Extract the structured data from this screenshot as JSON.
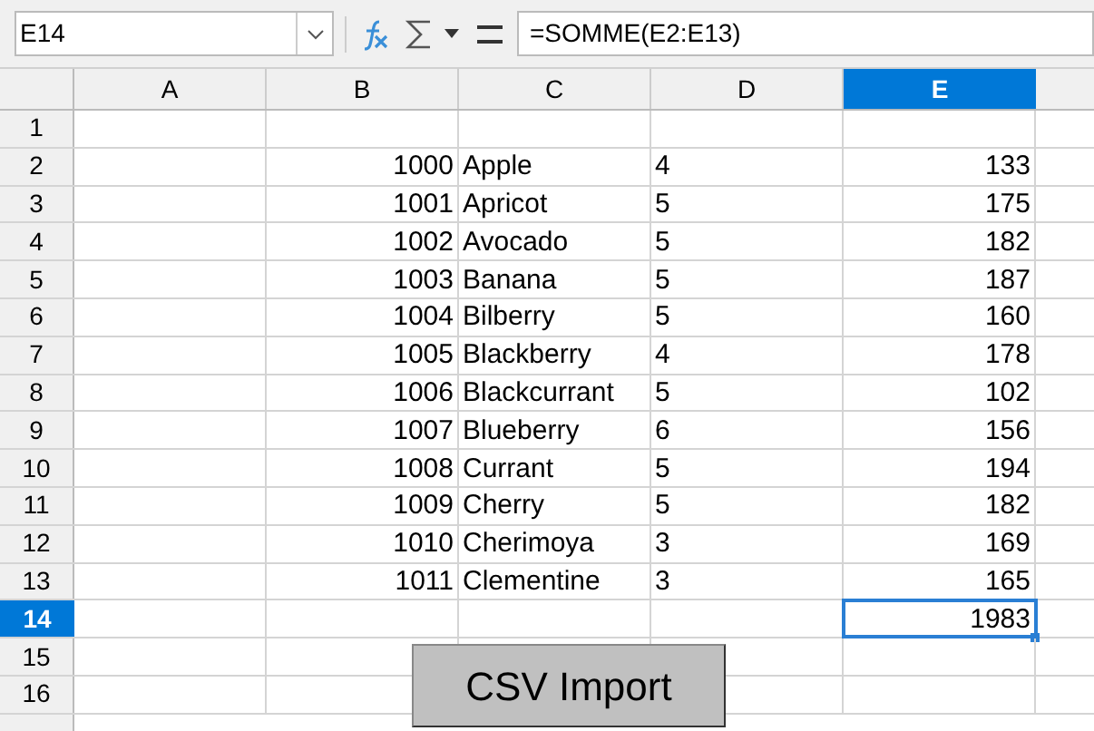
{
  "name_box": "E14",
  "formula": "=SOMME(E2:E13)",
  "columns": [
    {
      "label": "A",
      "selected": false,
      "kind": "text"
    },
    {
      "label": "B",
      "selected": false,
      "kind": "number"
    },
    {
      "label": "C",
      "selected": false,
      "kind": "text"
    },
    {
      "label": "D",
      "selected": false,
      "kind": "text"
    },
    {
      "label": "E",
      "selected": true,
      "kind": "number"
    }
  ],
  "rows": [
    {
      "label": "1",
      "selected": false,
      "cells": []
    },
    {
      "label": "2",
      "selected": false,
      "cells": [
        "",
        "1000",
        "Apple",
        "4",
        "133"
      ]
    },
    {
      "label": "3",
      "selected": false,
      "cells": [
        "",
        "1001",
        "Apricot",
        "5",
        "175"
      ]
    },
    {
      "label": "4",
      "selected": false,
      "cells": [
        "",
        "1002",
        "Avocado",
        "5",
        "182"
      ]
    },
    {
      "label": "5",
      "selected": false,
      "cells": [
        "",
        "1003",
        "Banana",
        "5",
        "187"
      ]
    },
    {
      "label": "6",
      "selected": false,
      "cells": [
        "",
        "1004",
        "Bilberry",
        "5",
        "160"
      ]
    },
    {
      "label": "7",
      "selected": false,
      "cells": [
        "",
        "1005",
        "Blackberry",
        "4",
        "178"
      ]
    },
    {
      "label": "8",
      "selected": false,
      "cells": [
        "",
        "1006",
        "Blackcurrant",
        "5",
        "102"
      ]
    },
    {
      "label": "9",
      "selected": false,
      "cells": [
        "",
        "1007",
        "Blueberry",
        "6",
        "156"
      ]
    },
    {
      "label": "10",
      "selected": false,
      "cells": [
        "",
        "1008",
        "Currant",
        "5",
        "194"
      ]
    },
    {
      "label": "11",
      "selected": false,
      "cells": [
        "",
        "1009",
        "Cherry",
        "5",
        "182"
      ]
    },
    {
      "label": "12",
      "selected": false,
      "cells": [
        "",
        "1010",
        "Cherimoya",
        "3",
        "169"
      ]
    },
    {
      "label": "13",
      "selected": false,
      "cells": [
        "",
        "1011",
        "Clementine",
        "3",
        "165"
      ]
    },
    {
      "label": "14",
      "selected": true,
      "cells": [
        "",
        "",
        "",
        "",
        "1983"
      ]
    },
    {
      "label": "15",
      "selected": false,
      "cells": []
    },
    {
      "label": "16",
      "selected": false,
      "cells": []
    }
  ],
  "button": "CSV Import"
}
